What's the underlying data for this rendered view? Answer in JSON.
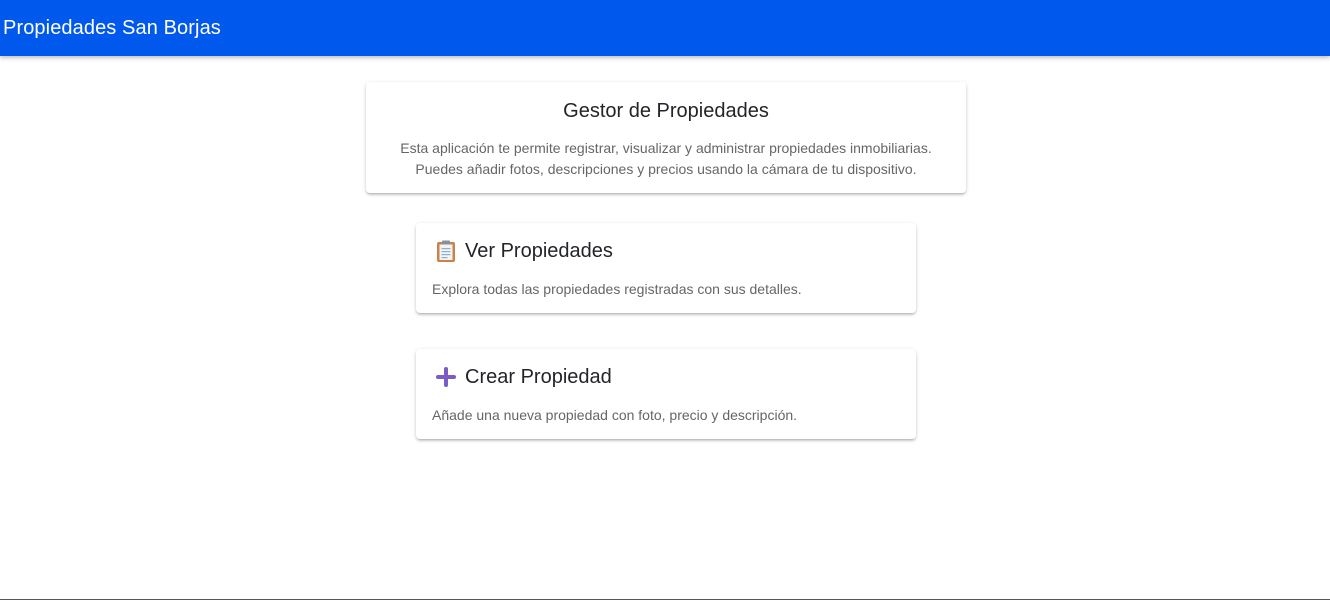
{
  "app": {
    "title": "Propiedades San Borjas"
  },
  "intro": {
    "title": "Gestor de Propiedades",
    "description": "Esta aplicación te permite registrar, visualizar y administrar propiedades inmobiliarias. Puedes añadir fotos, descripciones y precios usando la cámara de tu dispositivo."
  },
  "actions": [
    {
      "icon": "clipboard-icon",
      "title": "Ver Propiedades",
      "description": "Explora todas las propiedades registradas con sus detalles."
    },
    {
      "icon": "plus-icon",
      "title": "Crear Propiedad",
      "description": "Añade una nueva propiedad con foto, precio y descripción."
    }
  ],
  "colors": {
    "toolbar": "#0059ec",
    "plus_icon": "#7b5cc4"
  }
}
